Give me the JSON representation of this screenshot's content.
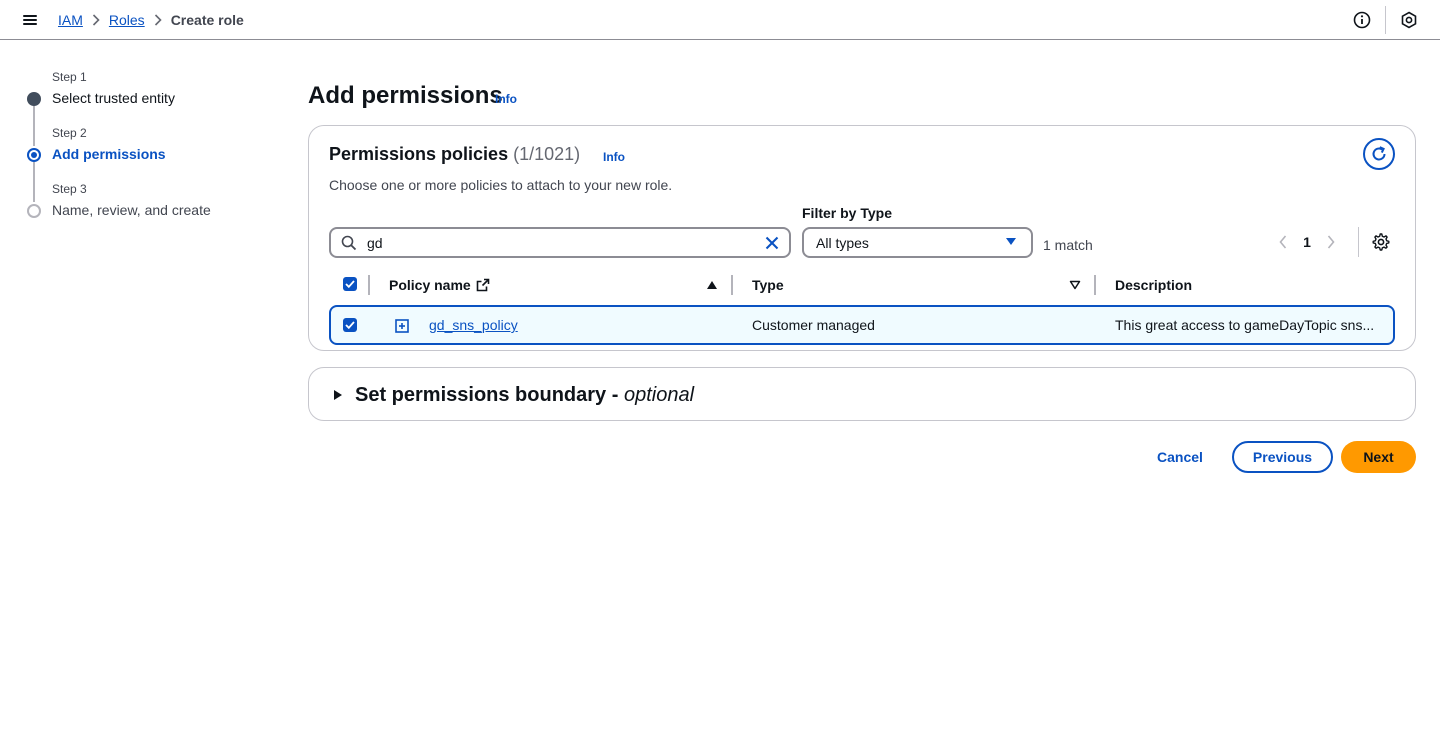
{
  "breadcrumb": {
    "items": [
      {
        "label": "IAM"
      },
      {
        "label": "Roles"
      },
      {
        "label": "Create role"
      }
    ]
  },
  "topbar": {
    "icons": [
      "menu-icon",
      "info-circle-icon",
      "notification-icon"
    ]
  },
  "steps": [
    {
      "step_label": "Step 1",
      "title": "Select trusted entity",
      "state": "completed"
    },
    {
      "step_label": "Step 2",
      "title": "Add permissions",
      "state": "current"
    },
    {
      "step_label": "Step 3",
      "title": "Name, review, and create",
      "state": "upcoming"
    }
  ],
  "page": {
    "title": "Add permissions",
    "info_label": "Info"
  },
  "policies": {
    "title": "Permissions policies",
    "count": "(1/1021)",
    "info_label": "Info",
    "description": "Choose one or more policies to attach to your new role.",
    "search_value": "gd",
    "filter_label": "Filter by Type",
    "filter_value": "All types",
    "match_text": "1 match",
    "current_page": "1",
    "columns": {
      "name": "Policy name",
      "type": "Type",
      "description": "Description"
    },
    "rows": [
      {
        "name": "gd_sns_policy",
        "type": "Customer managed",
        "description": "This great access to gameDayTopic sns...",
        "selected": true
      }
    ]
  },
  "boundary": {
    "title": "Set permissions boundary - ",
    "optional": "optional"
  },
  "footer": {
    "cancel_label": "Cancel",
    "previous_label": "Previous",
    "next_label": "Next"
  },
  "colors": {
    "accent": "#0a52c2",
    "primary_button": "#ff9900",
    "selected_row_bg": "#f0fbff"
  }
}
